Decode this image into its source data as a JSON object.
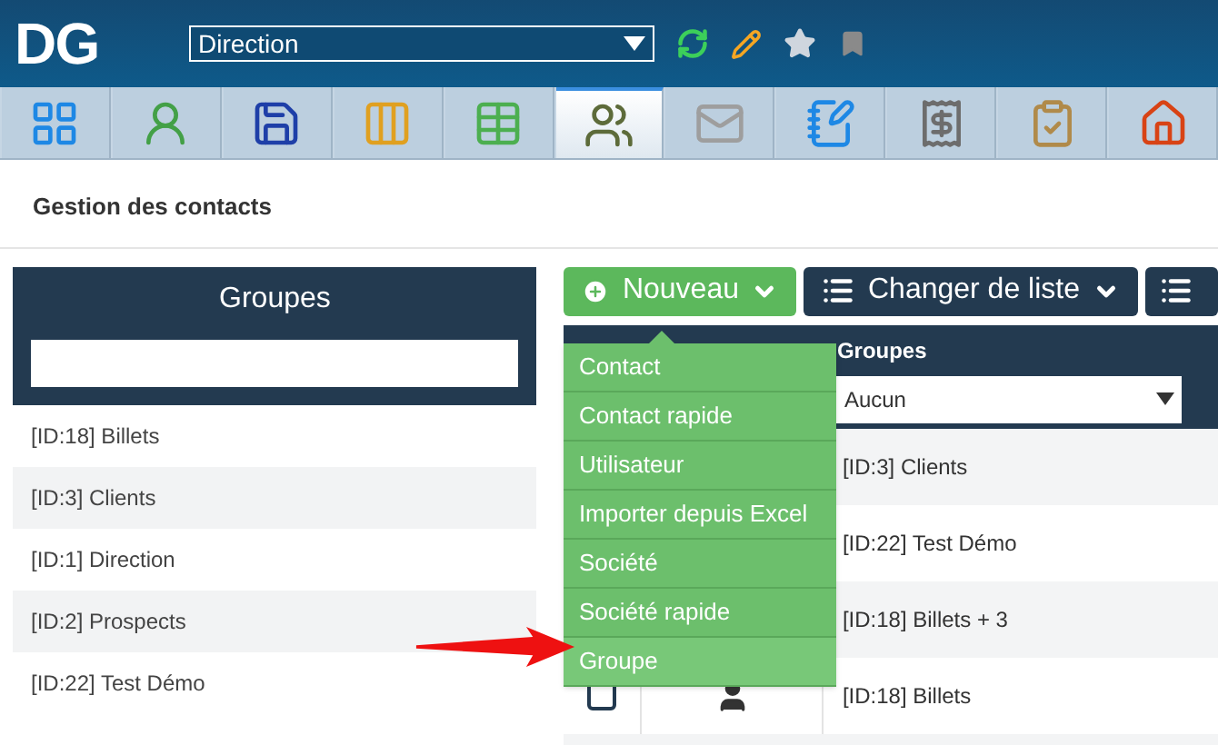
{
  "header": {
    "logo": "DG",
    "context_select": {
      "value": "Direction"
    }
  },
  "tabs": [
    {
      "kind": "apps",
      "selected": false
    },
    {
      "kind": "user",
      "selected": false
    },
    {
      "kind": "save",
      "selected": false
    },
    {
      "kind": "board",
      "selected": false
    },
    {
      "kind": "table",
      "selected": false
    },
    {
      "kind": "contacts",
      "selected": true
    },
    {
      "kind": "mail",
      "selected": false
    },
    {
      "kind": "notes",
      "selected": false
    },
    {
      "kind": "invoice",
      "selected": false
    },
    {
      "kind": "checklist",
      "selected": false
    },
    {
      "kind": "home",
      "selected": false
    }
  ],
  "page_title": "Gestion des contacts",
  "groups_panel": {
    "title": "Groupes",
    "items": [
      "[ID:18] Billets",
      "[ID:3] Clients",
      "[ID:1] Direction",
      "[ID:2] Prospects",
      "[ID:22] Test Démo"
    ]
  },
  "toolbar": {
    "new_button": "Nouveau",
    "change_list_button": "Changer de liste"
  },
  "new_menu": [
    {
      "label": "Contact",
      "selected": false
    },
    {
      "label": "Contact rapide",
      "selected": false
    },
    {
      "label": "Utilisateur",
      "selected": false
    },
    {
      "label": "Importer depuis Excel",
      "selected": false
    },
    {
      "label": "Société",
      "selected": false
    },
    {
      "label": "Société rapide",
      "selected": false
    },
    {
      "label": "Groupe",
      "selected": true
    }
  ],
  "table": {
    "groups_column": "Groupes",
    "groups_filter": {
      "value": "Aucun"
    },
    "rows": [
      {
        "groups": "[ID:3] Clients"
      },
      {
        "groups": "[ID:22] Test Démo"
      },
      {
        "groups": "[ID:18] Billets + 3"
      },
      {
        "groups": "[ID:18] Billets",
        "checked": false,
        "kind": "person"
      }
    ]
  }
}
